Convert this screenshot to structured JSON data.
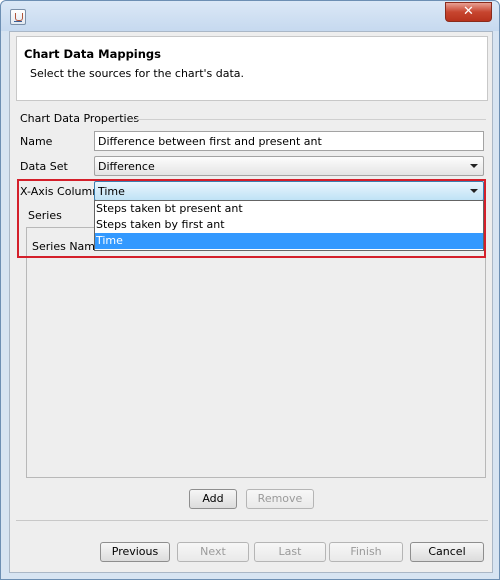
{
  "window": {
    "close_glyph": "✕"
  },
  "header": {
    "title": "Chart Data Mappings",
    "subtitle": "Select the sources for the chart's data."
  },
  "properties": {
    "section_label": "Chart Data Properties",
    "name_label": "Name",
    "name_value": "Difference between first and present ant",
    "dataset_label": "Data Set",
    "dataset_value": "Difference",
    "xaxis_label": "X-Axis Column",
    "xaxis_value": "Time",
    "xaxis_options": [
      "Steps taken bt present ant",
      "Steps taken by first ant",
      "Time"
    ]
  },
  "series": {
    "group_label": "Series",
    "column_header": "Series Name",
    "add_label": "Add",
    "remove_label": "Remove"
  },
  "footer": {
    "previous_label": "Previous",
    "next_label": "Next",
    "last_label": "Last",
    "finish_label": "Finish",
    "cancel_label": "Cancel"
  },
  "colors": {
    "highlight": "#d41f2a",
    "selection": "#3399ff"
  }
}
